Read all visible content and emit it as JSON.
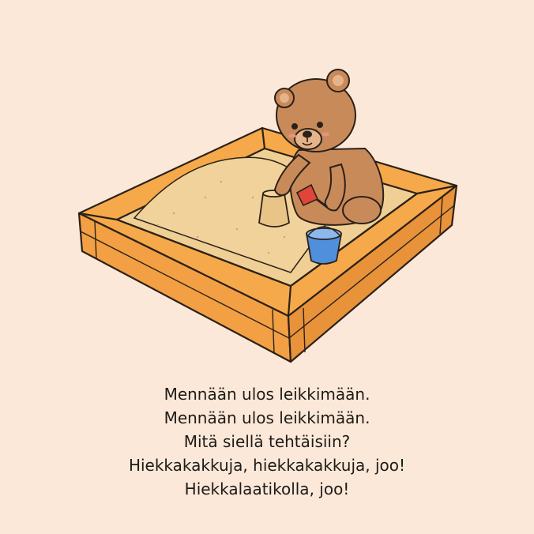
{
  "verse": {
    "lines": [
      "Mennään ulos leikkimään.",
      "Mennään ulos leikkimään.",
      "Mitä siellä tehtäisiin?",
      "Hiekkakakkuja, hiekkakakkuja, joo!",
      "Hiekkalaatikolla, joo!"
    ]
  },
  "colors": {
    "background": "#fbe8d8",
    "frame": "#f6a94a",
    "frame_shadow": "#e8923a",
    "sand": "#efcf94",
    "bear": "#c98a5a",
    "bear_light": "#e6b48a",
    "bucket": "#4f8fdc",
    "shovel": "#e0453a",
    "outline": "#2b2118",
    "text": "#1e1b18"
  },
  "icons": {
    "bear": "teddy-bear",
    "sandbox": "sandbox",
    "bucket": "sand-bucket",
    "shovel": "toy-shovel",
    "sandcastle": "sand-cake"
  }
}
